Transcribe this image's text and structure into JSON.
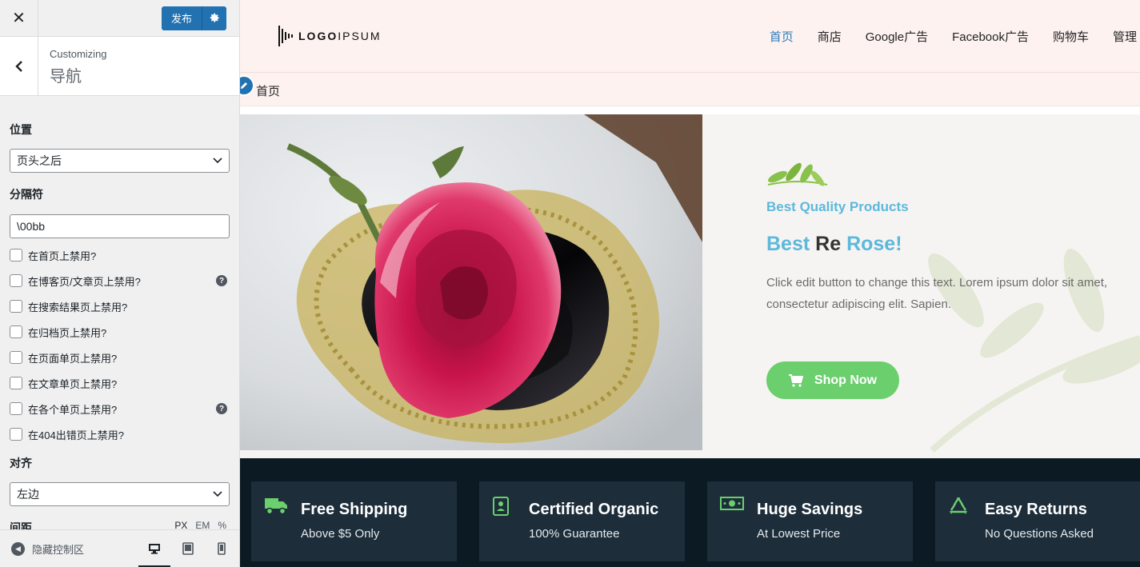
{
  "customizer": {
    "close_glyph": "✕",
    "publish_label": "发布",
    "back_glyph": "‹",
    "section_kicker": "Customizing",
    "section_title": "导航",
    "position": {
      "label": "位置",
      "value": "页头之后"
    },
    "separator": {
      "label": "分隔符",
      "value": "\\00bb"
    },
    "checkboxes": [
      {
        "label": "在首页上禁用?",
        "checked": false,
        "help": false
      },
      {
        "label": "在博客页/文章页上禁用?",
        "checked": false,
        "help": true
      },
      {
        "label": "在搜索结果页上禁用?",
        "checked": false,
        "help": false
      },
      {
        "label": "在归档页上禁用?",
        "checked": false,
        "help": false
      },
      {
        "label": "在页面单页上禁用?",
        "checked": false,
        "help": false
      },
      {
        "label": "在文章单页上禁用?",
        "checked": false,
        "help": false
      },
      {
        "label": "在各个单页上禁用?",
        "checked": false,
        "help": true
      },
      {
        "label": "在404出错页上禁用?",
        "checked": false,
        "help": false
      }
    ],
    "alignment": {
      "label": "对齐",
      "value": "左边"
    },
    "spacing": {
      "label": "间距",
      "units": [
        "PX",
        "EM",
        "%"
      ],
      "active_unit": "PX"
    },
    "help_glyph": "?",
    "footer": {
      "hide_controls_label": "隐藏控制区",
      "devices": [
        "desktop-icon",
        "tablet-icon",
        "mobile-icon"
      ],
      "active_device": "desktop"
    }
  },
  "site": {
    "logo": {
      "part1": "LOGO",
      "part2": "IPSUM"
    },
    "nav": [
      {
        "label": "首页",
        "active": true
      },
      {
        "label": "商店",
        "active": false
      },
      {
        "label": "Google广告",
        "active": false
      },
      {
        "label": "Facebook广告",
        "active": false
      },
      {
        "label": "购物车",
        "active": false
      },
      {
        "label": "管理",
        "active": false
      }
    ],
    "breadcrumb": "首页",
    "hero": {
      "kicker": "Best Quality Products",
      "title_part1": "Best",
      "title_part2": "Re",
      "title_part3": "Rose!",
      "description": "Click edit button to change this text. Lorem ipsum dolor sit amet, consectetur adipiscing elit. Sapien.",
      "button_label": "Shop Now"
    },
    "features": [
      {
        "icon": "truck-icon",
        "title": "Free Shipping",
        "subtitle": "Above $5 Only"
      },
      {
        "icon": "certificate-icon",
        "title": "Certified Organic",
        "subtitle": "100% Guarantee"
      },
      {
        "icon": "money-icon",
        "title": "Huge Savings",
        "subtitle": "At Lowest Price"
      },
      {
        "icon": "recycle-icon",
        "title": "Easy Returns",
        "subtitle": "No Questions Asked"
      }
    ],
    "colors": {
      "accent_blue": "#5cb8dc",
      "button_green": "#6bcf6e",
      "header_bg": "#fdf2f0",
      "features_bg": "#0c1a24",
      "feature_card_bg": "#1d2d3a",
      "wp_blue": "#2271b1"
    }
  }
}
